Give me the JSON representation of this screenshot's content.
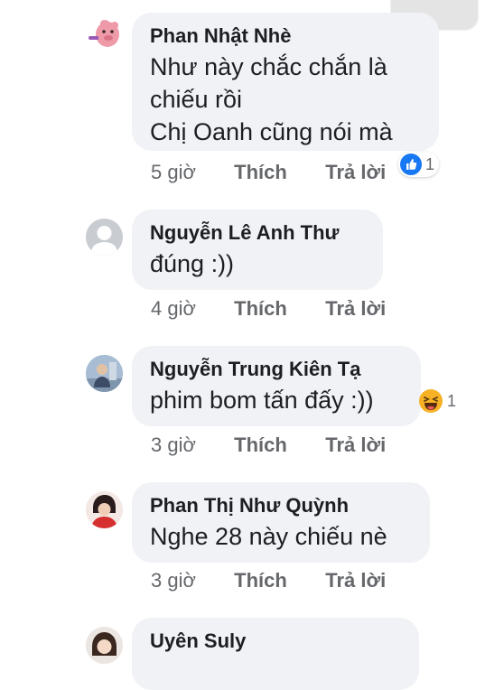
{
  "labels": {
    "like": "Thích",
    "reply": "Trả lời"
  },
  "comments": [
    {
      "name": "Phan Nhật Nhè",
      "text": "Như này chắc chắn là\nchiếu rồi\nChị Oanh cũng nói mà",
      "time": "5 giờ",
      "reaction": {
        "icon": "like-icon",
        "count": "1",
        "color": "#1877f2"
      }
    },
    {
      "name": "Nguyễn Lê Anh Thư",
      "text": "đúng :))",
      "time": "4 giờ"
    },
    {
      "name": "Nguyễn Trung Kiên Tạ",
      "text": "phim bom tấn đấy :))",
      "time": "3 giờ",
      "reaction": {
        "icon": "haha-icon",
        "count": "1",
        "color": "#f7b125"
      }
    },
    {
      "name": "Phan Thị Như Quỳnh",
      "text": "Nghe 28 này chiếu nè",
      "time": "3 giờ"
    },
    {
      "name": "Uyên Suly"
    }
  ]
}
